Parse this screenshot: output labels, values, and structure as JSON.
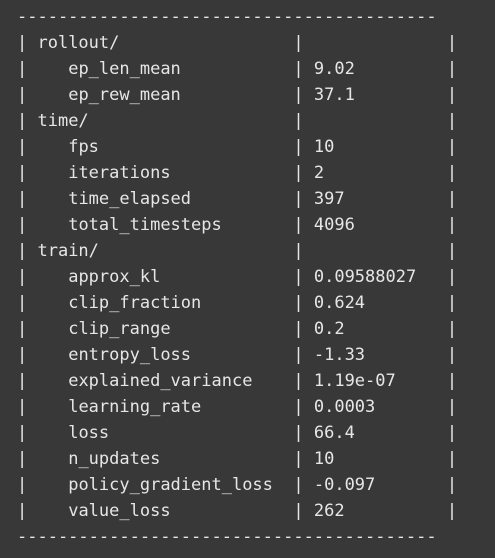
{
  "border_line": "-----------------------------------------",
  "sections": [
    {
      "name": "rollout/",
      "rows": [
        {
          "key": "ep_len_mean",
          "value": "9.02"
        },
        {
          "key": "ep_rew_mean",
          "value": "37.1"
        }
      ]
    },
    {
      "name": "time/",
      "rows": [
        {
          "key": "fps",
          "value": "10"
        },
        {
          "key": "iterations",
          "value": "2"
        },
        {
          "key": "time_elapsed",
          "value": "397"
        },
        {
          "key": "total_timesteps",
          "value": "4096"
        }
      ]
    },
    {
      "name": "train/",
      "rows": [
        {
          "key": "approx_kl",
          "value": "0.09588027"
        },
        {
          "key": "clip_fraction",
          "value": "0.624"
        },
        {
          "key": "clip_range",
          "value": "0.2"
        },
        {
          "key": "entropy_loss",
          "value": "-1.33"
        },
        {
          "key": "explained_variance",
          "value": "1.19e-07"
        },
        {
          "key": "learning_rate",
          "value": "0.0003"
        },
        {
          "key": "loss",
          "value": "66.4"
        },
        {
          "key": "n_updates",
          "value": "10"
        },
        {
          "key": "policy_gradient_loss",
          "value": "-0.097"
        },
        {
          "key": "value_loss",
          "value": "262"
        }
      ]
    }
  ],
  "colors": {
    "background": "#383838",
    "text": "#e6e6e6"
  }
}
